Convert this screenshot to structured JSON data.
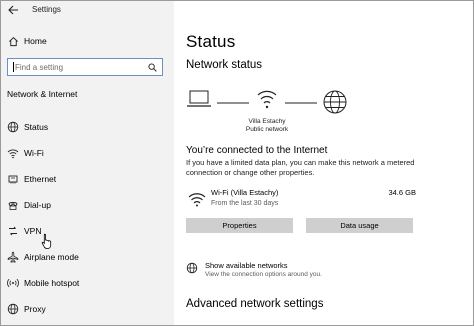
{
  "window": {
    "title": "Settings"
  },
  "sidebar": {
    "home_label": "Home",
    "search_placeholder": "Find a setting",
    "section_title": "Network & Internet",
    "items": [
      {
        "label": "Status",
        "icon": "globe-icon"
      },
      {
        "label": "Wi-Fi",
        "icon": "wifi-icon"
      },
      {
        "label": "Ethernet",
        "icon": "ethernet-icon"
      },
      {
        "label": "Dial-up",
        "icon": "dialup-icon"
      },
      {
        "label": "VPN",
        "icon": "vpn-icon"
      },
      {
        "label": "Airplane mode",
        "icon": "airplane-icon"
      },
      {
        "label": "Mobile hotspot",
        "icon": "hotspot-icon"
      },
      {
        "label": "Proxy",
        "icon": "globe-icon"
      }
    ]
  },
  "main": {
    "title": "Status",
    "network_status_heading": "Network status",
    "network_name": "Villa Estachy",
    "network_type": "Public network",
    "connected_heading": "You’re connected to the Internet",
    "description": "If you have a limited data plan, you can make this network a metered connection or change other properties.",
    "connection": {
      "name": "Wi-Fi (Villa Estachy)",
      "period": "From the last 30 days",
      "usage": "34.6 GB"
    },
    "buttons": {
      "properties": "Properties",
      "data_usage": "Data usage"
    },
    "show_networks": {
      "title": "Show available networks",
      "subtitle": "View the connection options around you."
    },
    "advanced_heading": "Advanced network settings"
  },
  "colors": {
    "sidebar_bg": "#f2f2f2",
    "button_bg": "#cfcfcf",
    "search_border": "#6b8fc7"
  }
}
